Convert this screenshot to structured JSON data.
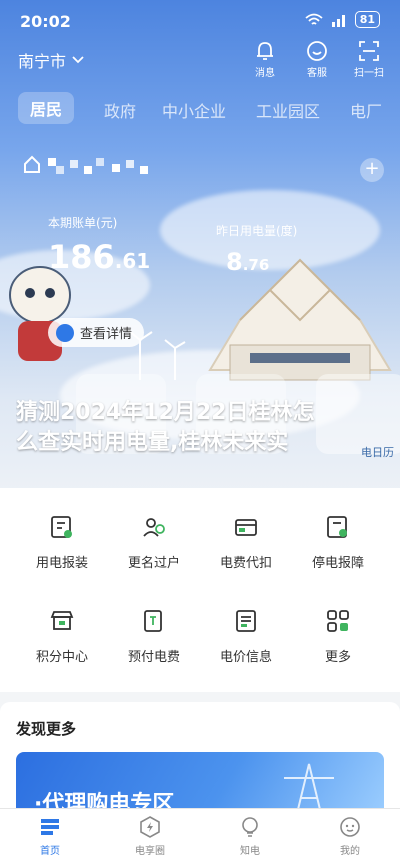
{
  "status_bar": {
    "time": "20:02",
    "battery": "81"
  },
  "header": {
    "city": "南宁市",
    "actions": [
      {
        "label": "消息",
        "icon": "bell-icon"
      },
      {
        "label": "客服",
        "icon": "service-smile-icon"
      },
      {
        "label": "扫一扫",
        "icon": "scan-icon"
      }
    ]
  },
  "tabs": [
    "居民",
    "政府",
    "中小企业",
    "工业园区",
    "电厂"
  ],
  "account": {
    "bill_label": "本期账单(元)",
    "bill_int": "186",
    "bill_dec": ".61",
    "usage_label": "昨日用电量(度)",
    "usage_int": "8",
    "usage_dec": ".76",
    "detail_button": "查看详情",
    "add_button": "+"
  },
  "overlay_title": {
    "line1": "猜测2024年12月22日桂林怎",
    "line2": "么查实时用电量,桂林未来实"
  },
  "side_label": "电日历",
  "services": [
    {
      "label": "用电报装",
      "icon": "install-icon"
    },
    {
      "label": "更名过户",
      "icon": "transfer-user-icon"
    },
    {
      "label": "电费代扣",
      "icon": "autopay-card-icon"
    },
    {
      "label": "停电报障",
      "icon": "outage-report-icon"
    },
    {
      "label": "积分中心",
      "icon": "points-store-icon"
    },
    {
      "label": "预付电费",
      "icon": "prepay-icon"
    },
    {
      "label": "电价信息",
      "icon": "price-doc-icon"
    },
    {
      "label": "更多",
      "icon": "more-grid-icon"
    }
  ],
  "discover": {
    "title": "发现更多",
    "banner_text": "·代理购电专区"
  },
  "bottom_nav": [
    {
      "label": "首页",
      "icon": "home-icon",
      "active": true
    },
    {
      "label": "电享圈",
      "icon": "circle-bolt-icon",
      "active": false
    },
    {
      "label": "知电",
      "icon": "bulb-icon",
      "active": false
    },
    {
      "label": "我的",
      "icon": "profile-icon",
      "active": false
    }
  ],
  "colors": {
    "accent": "#2e78e6",
    "hero_top": "#4d84df"
  }
}
